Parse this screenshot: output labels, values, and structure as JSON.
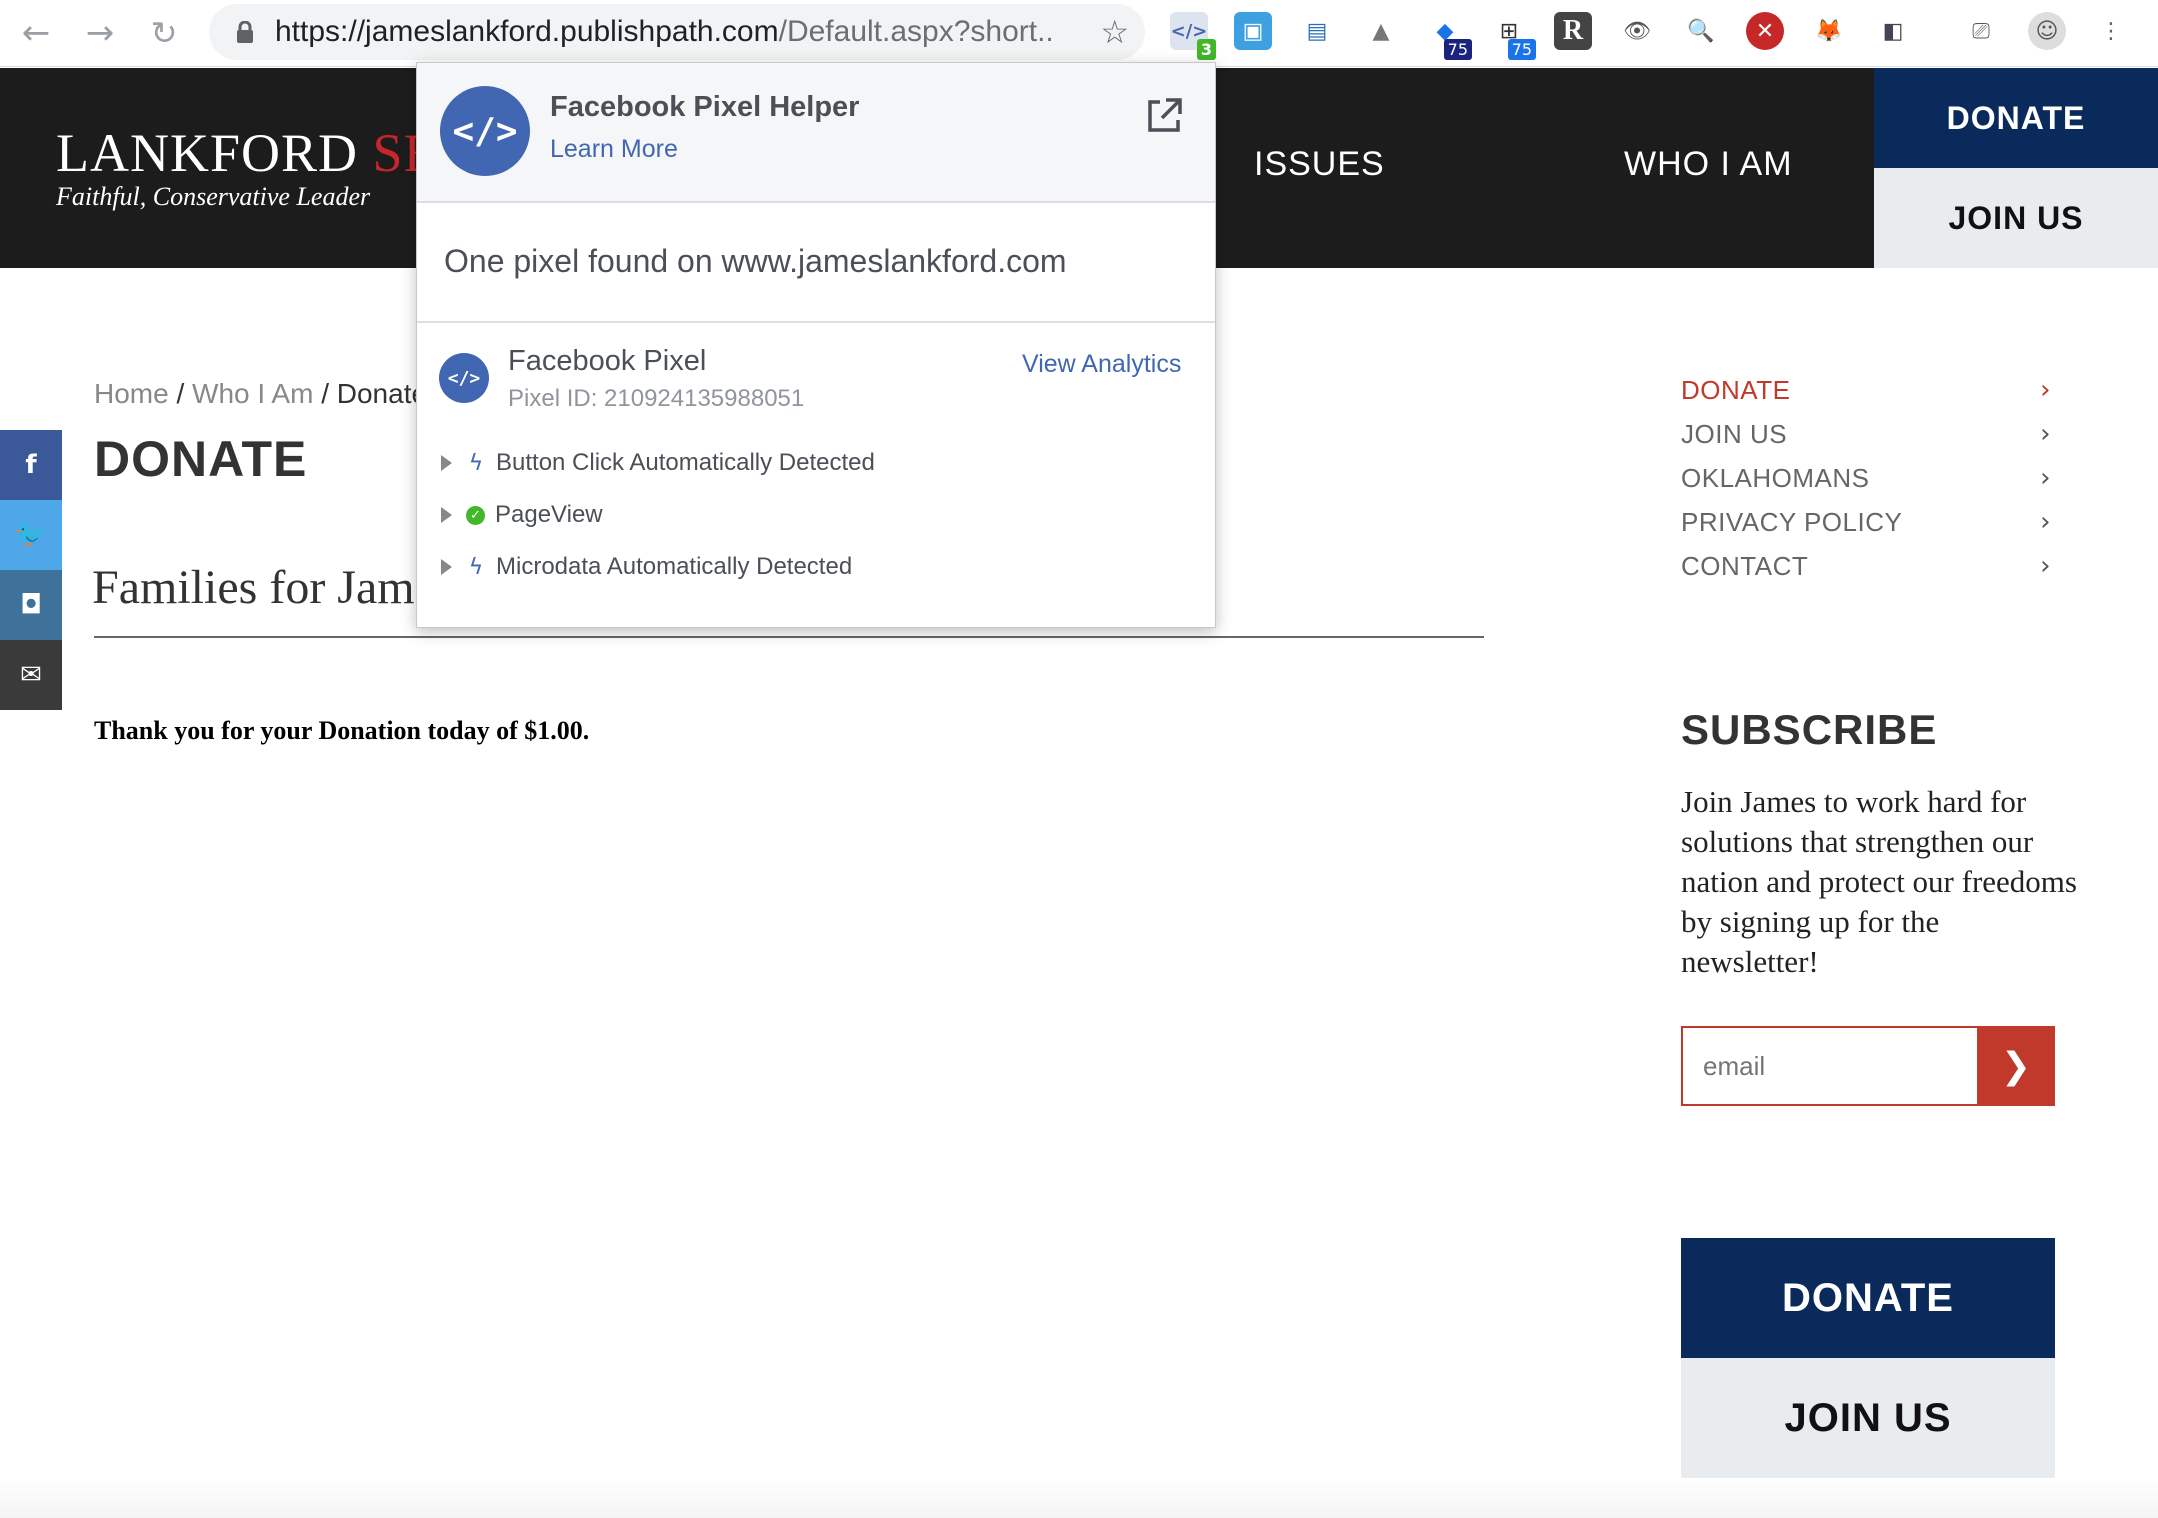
{
  "browser": {
    "url_main": "https://jameslankford.publishpath.com",
    "url_rest": "/Default.aspx?short...",
    "ext_badge_pixel": "3",
    "ext_badge_a": "75",
    "ext_badge_b": "75",
    "ext_r": "R"
  },
  "site": {
    "logo_main": "LANKFORD",
    "logo_red": "SE",
    "tagline": "Faithful, Conservative Leader",
    "nav_issues": "ISSUES",
    "nav_who": "WHO I AM",
    "header_donate": "DONATE",
    "header_join": "JOIN US"
  },
  "breadcrumb": {
    "home": "Home",
    "sep1": "/",
    "who": "Who I Am",
    "sep2": "/",
    "current": "Donate"
  },
  "page": {
    "title": "DONATE",
    "subheading": "Families for Jam",
    "thanks": "Thank you for your Donation today of $1.00."
  },
  "sidebar": {
    "items": [
      {
        "label": "DONATE"
      },
      {
        "label": "JOIN US"
      },
      {
        "label": "OKLAHOMANS"
      },
      {
        "label": "PRIVACY POLICY"
      },
      {
        "label": "CONTACT"
      }
    ],
    "chevron": "›",
    "subscribe_title": "SUBSCRIBE",
    "subscribe_text": "Join James to work hard for solutions that strengthen our nation and protect our freedoms by signing up for the newsletter!",
    "email_placeholder": "email",
    "donate": "DONATE",
    "join": "JOIN US"
  },
  "social": {
    "facebook": "f",
    "twitter": "🐦",
    "instagram": "◘",
    "email": "✉",
    "colors": {
      "facebook": "#3b5998",
      "twitter": "#4da7e8",
      "instagram": "#3f729b",
      "email": "#3a3a3a"
    }
  },
  "popup": {
    "title": "Facebook Pixel Helper",
    "learn_more": "Learn More",
    "found": "One pixel found on www.jameslankford.com",
    "pixel_name": "Facebook Pixel",
    "pixel_id": "Pixel ID: 210924135988051",
    "view_analytics": "View Analytics",
    "events": [
      {
        "label": "Button Click Automatically Detected",
        "icon": "bolt-icon"
      },
      {
        "label": "PageView",
        "icon": "check-icon"
      },
      {
        "label": "Microdata Automatically Detected",
        "icon": "bolt-icon"
      }
    ]
  }
}
